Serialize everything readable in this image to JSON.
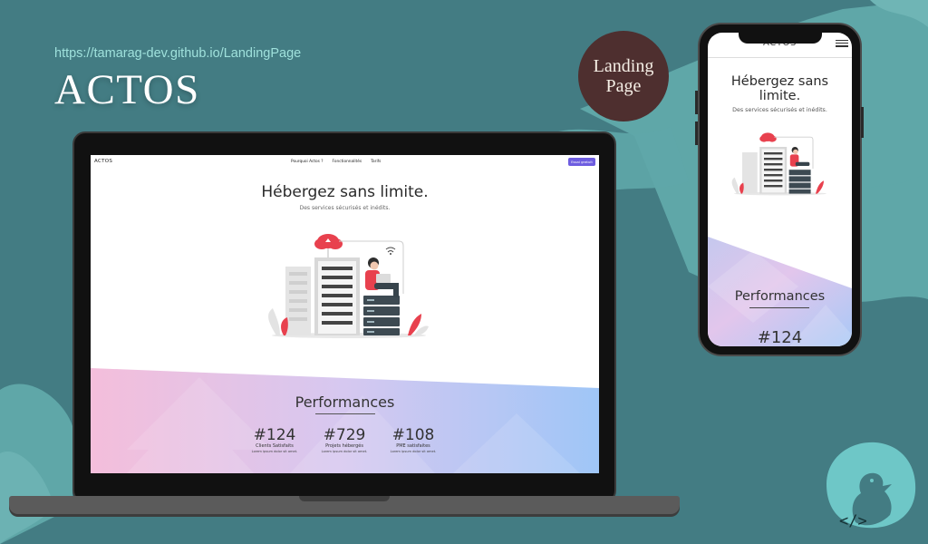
{
  "header": {
    "url": "https://tamarag-dev.github.io/LandingPage",
    "brand": "ACTOS"
  },
  "badge": {
    "line1": "Landing",
    "line2": "Page"
  },
  "desktop": {
    "nav": {
      "logo": "ACTOS",
      "links": [
        "Pourquoi Actos ?",
        "Fonctionnalités",
        "Tarifs"
      ],
      "cta": "Essai gratuit"
    },
    "hero": {
      "title": "Hébergez sans limite.",
      "subtitle": "Des services sécurisés et inédits."
    },
    "performances": {
      "title": "Performances",
      "stats": [
        {
          "number": "#124",
          "label": "Clients Satisfaits",
          "lorem": "Lorem ipsum dolor sit amet."
        },
        {
          "number": "#729",
          "label": "Projets hébergés",
          "lorem": "Lorem ipsum dolor sit amet."
        },
        {
          "number": "#108",
          "label": "PME satisfaites",
          "lorem": "Lorem ipsum dolor sit amet."
        }
      ]
    }
  },
  "mobile": {
    "brand": "ACTOS",
    "hero": {
      "title": "Hébergez sans limite.",
      "subtitle": "Des services sécurisés et inédits."
    },
    "performances": {
      "title": "Performances",
      "first_stat": "#124"
    }
  },
  "footer": {
    "code_icon": "</>"
  },
  "colors": {
    "background": "#437c83",
    "brush": "#5fa7a8",
    "badge": "#4e2f2f",
    "cta": "#6e5de0",
    "accent_red": "#e8414e"
  },
  "icons": [
    "hamburger-menu-icon",
    "code-icon",
    "duck-logo-icon",
    "cloud-upload-icon",
    "wifi-icon"
  ]
}
